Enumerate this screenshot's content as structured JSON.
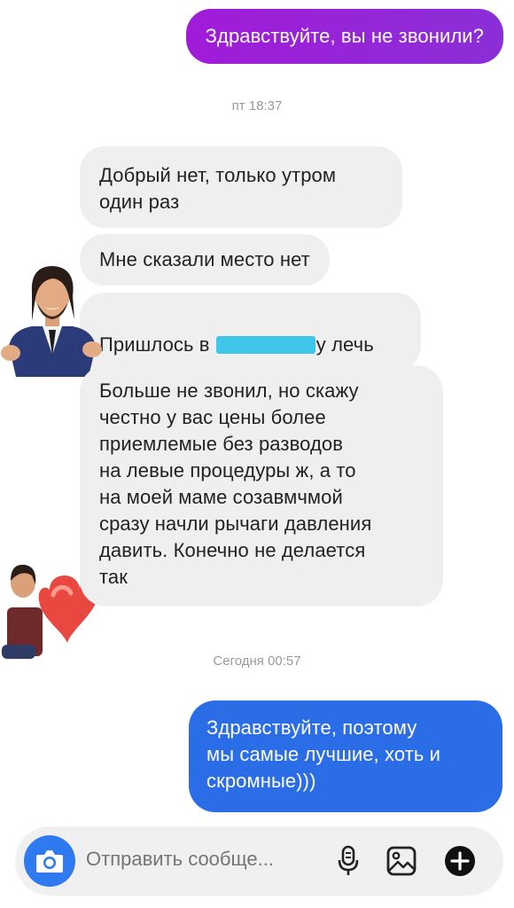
{
  "messages": {
    "outgoing_top": "Здравствуйте, вы не звонили?",
    "timestamp_1": "пт 18:37",
    "incoming_1": "Добрый нет, только утром\nодин раз",
    "incoming_2": "Мне сказали место нет",
    "incoming_3_before": "Пришлось в ",
    "incoming_3_after": "у лечь",
    "incoming_4": "Больше не звонил, но скажу\nчестно у вас цены более\nприемлемые без разводов\nна левые процедуры ж, а то\nна моей маме созавмчмой\nсразу начли рычаги давления\nдавить. Конечно не делается\nтак",
    "timestamp_2": "Сегодня 00:57",
    "outgoing_bottom": "Здравствуйте, поэтому\nмы самые лучшие, хоть и\nскромные)))"
  },
  "composer": {
    "placeholder": "Отправить сообще...",
    "icons": [
      "camera-icon",
      "microphone-icon",
      "gallery-icon",
      "plus-icon"
    ]
  },
  "colors": {
    "outgoing_top": "#a11bd8",
    "outgoing_bottom": "#2b6de6",
    "incoming": "#efefef",
    "camera": "#2f7af0",
    "redaction": "#3ec7e8"
  }
}
